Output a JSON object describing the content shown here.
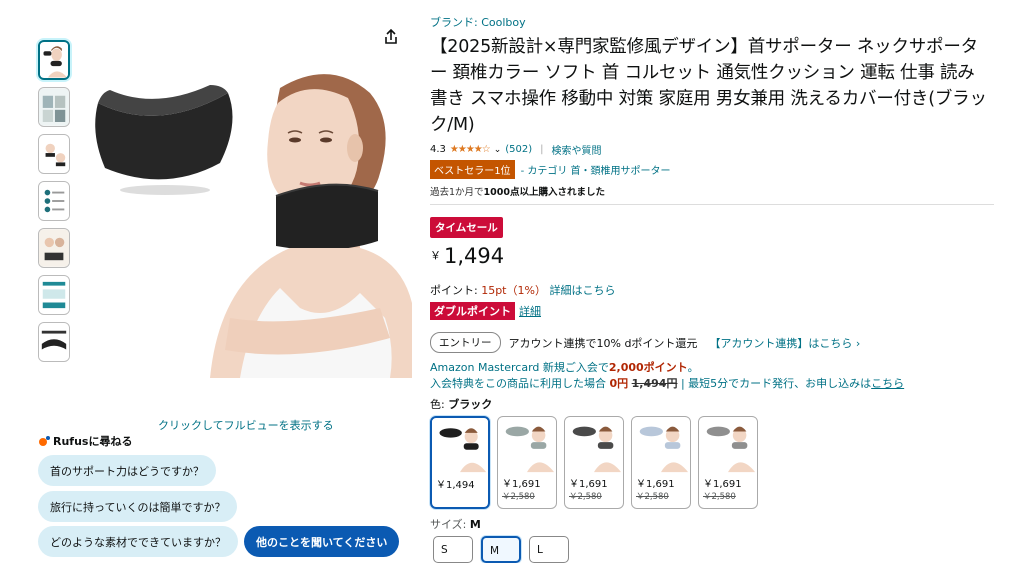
{
  "gallery": {
    "fullview_link": "クリックしてフルビューを表示する",
    "thumb_count": 7,
    "share_icon": "share-icon"
  },
  "rufus": {
    "title": "Rufusに尋ねる",
    "questions": [
      "首のサポート力はどうですか？",
      "旅行に持っていくのは簡単ですか？",
      "どのような素材でできていますか？"
    ],
    "other_button": "他のことを聞いてください"
  },
  "product": {
    "brand": "ブランド: Coolboy",
    "title": "【2025新設計×専門家監修風デザイン】首サポーター ネックサポーター 頚椎カラー ソフト 首 コルセット 通気性クッション 運転 仕事 読み 書き スマホ操作 移動中 対策 家庭用 男女兼用 洗えるカバー付き(ブラック/M)",
    "rating": "4.3",
    "rating_count": "(502)",
    "qa_link": "検索や質問",
    "bestseller": "ベストセラー1位",
    "category": "- カテゴリ 首・頚椎用サポーター",
    "bought_prefix": "過去1か月で",
    "bought_count": "1000点以上購入されました",
    "sale_badge": "タイムセール",
    "currency": "￥",
    "price": "1,494",
    "points_label": "ポイント: ",
    "points_value": "15pt（1%）",
    "points_link": "詳細はこちら",
    "double_point": "ダブルポイント",
    "double_point_link": "詳細",
    "entry_button": "エントリー",
    "entry_text": "アカウント連携で10% dポイント還元",
    "entry_link": "【アカウント連携】はこちら ›",
    "mc_line1_prefix": "Amazon Mastercard 新規ご入会で",
    "mc_line1_points": "2,000ポイント",
    "mc_line1_suffix": "。",
    "mc_line2_prefix": "入会特典をこの商品に利用した場合 ",
    "mc_line2_price": "0円",
    "mc_line2_old": "1,494円",
    "mc_line2_suffix": " | 最短5分でカード発行、お申し込みは",
    "mc_line2_link": "こちら",
    "color_label": "色: ",
    "color_value": "ブラック",
    "size_label": "サイズ: ",
    "size_value": "M"
  },
  "swatches": [
    {
      "color": "#1e1e1e",
      "price": "￥1,494",
      "old": ""
    },
    {
      "color": "#9aa7a5",
      "price": "￥1,691",
      "old": "￥2,580"
    },
    {
      "color": "#4a4a4a",
      "price": "￥1,691",
      "old": "￥2,580"
    },
    {
      "color": "#b8c7da",
      "price": "￥1,691",
      "old": "￥2,580"
    },
    {
      "color": "#8f8f8f",
      "price": "￥1,691",
      "old": "￥2,580"
    }
  ],
  "sizes": [
    "S",
    "M",
    "L"
  ],
  "colors": {
    "link": "#007185",
    "sale": "#cc0c39",
    "bestseller": "#c45500",
    "selected": "#0b5ab2"
  }
}
